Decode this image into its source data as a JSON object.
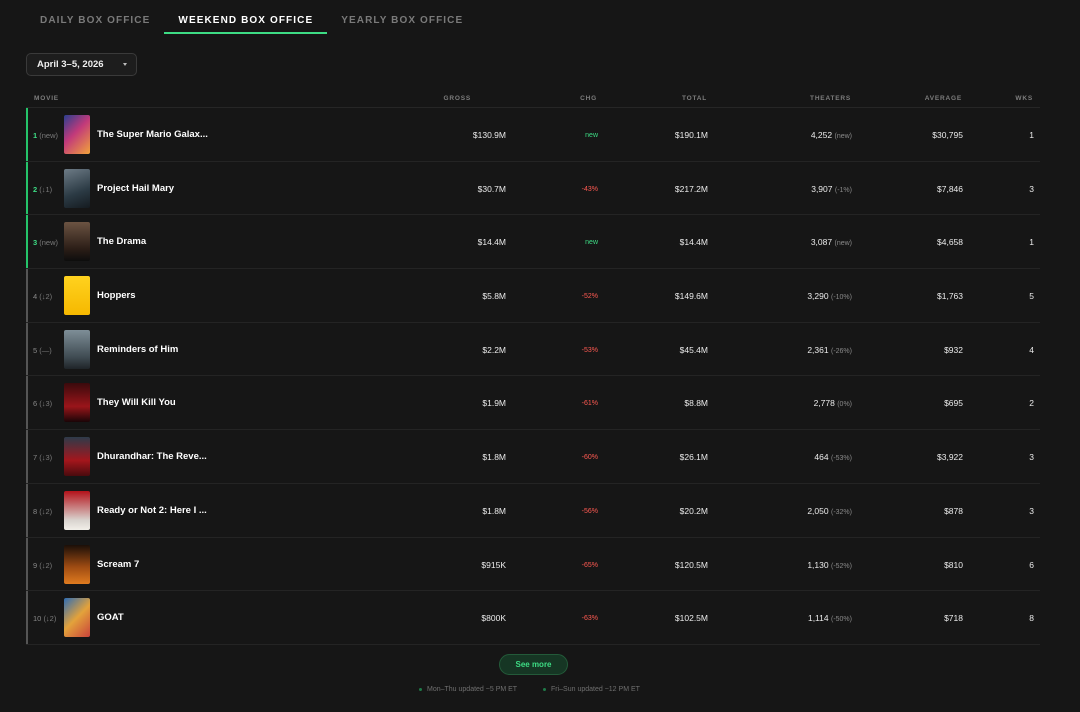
{
  "tabs": [
    {
      "label": "DAILY BOX OFFICE",
      "active": false
    },
    {
      "label": "WEEKEND BOX OFFICE",
      "active": true
    },
    {
      "label": "YEARLY BOX OFFICE",
      "active": false
    }
  ],
  "date_select": {
    "value": "April 3–5, 2026"
  },
  "columns": {
    "movie": "MOVIE",
    "gross": "GROSS",
    "chg": "CHG",
    "total": "TOTAL",
    "theaters": "THEATERS",
    "average": "AVERAGE",
    "wks": "WKS"
  },
  "rows": [
    {
      "rank": "1",
      "rank_change": "(new)",
      "title": "The Super Mario Galax...",
      "gross": "$130.9M",
      "chg": "new",
      "total": "$190.1M",
      "theaters": "4,252",
      "theaters_change": "(new)",
      "average": "$30,795",
      "wks": "1"
    },
    {
      "rank": "2",
      "rank_change": "(↓1)",
      "title": "Project Hail Mary",
      "gross": "$30.7M",
      "chg": "-43%",
      "total": "$217.2M",
      "theaters": "3,907",
      "theaters_change": "(-1%)",
      "average": "$7,846",
      "wks": "3"
    },
    {
      "rank": "3",
      "rank_change": "(new)",
      "title": "The Drama",
      "gross": "$14.4M",
      "chg": "new",
      "total": "$14.4M",
      "theaters": "3,087",
      "theaters_change": "(new)",
      "average": "$4,658",
      "wks": "1"
    },
    {
      "rank": "4",
      "rank_change": "(↓2)",
      "title": "Hoppers",
      "gross": "$5.8M",
      "chg": "-52%",
      "total": "$149.6M",
      "theaters": "3,290",
      "theaters_change": "(-10%)",
      "average": "$1,763",
      "wks": "5"
    },
    {
      "rank": "5",
      "rank_change": "(—)",
      "title": "Reminders of Him",
      "gross": "$2.2M",
      "chg": "-53%",
      "total": "$45.4M",
      "theaters": "2,361",
      "theaters_change": "(-26%)",
      "average": "$932",
      "wks": "4"
    },
    {
      "rank": "6",
      "rank_change": "(↓3)",
      "title": "They Will Kill You",
      "gross": "$1.9M",
      "chg": "-61%",
      "total": "$8.8M",
      "theaters": "2,778",
      "theaters_change": "(0%)",
      "average": "$695",
      "wks": "2"
    },
    {
      "rank": "7",
      "rank_change": "(↓3)",
      "title": "Dhurandhar: The Reve...",
      "gross": "$1.8M",
      "chg": "-60%",
      "total": "$26.1M",
      "theaters": "464",
      "theaters_change": "(-53%)",
      "average": "$3,922",
      "wks": "3"
    },
    {
      "rank": "8",
      "rank_change": "(↓2)",
      "title": "Ready or Not 2: Here I ...",
      "gross": "$1.8M",
      "chg": "-56%",
      "total": "$20.2M",
      "theaters": "2,050",
      "theaters_change": "(-32%)",
      "average": "$878",
      "wks": "3"
    },
    {
      "rank": "9",
      "rank_change": "(↓2)",
      "title": "Scream 7",
      "gross": "$915K",
      "chg": "-65%",
      "total": "$120.5M",
      "theaters": "1,130",
      "theaters_change": "(-52%)",
      "average": "$810",
      "wks": "6"
    },
    {
      "rank": "10",
      "rank_change": "(↓2)",
      "title": "GOAT",
      "gross": "$800K",
      "chg": "-63%",
      "total": "$102.5M",
      "theaters": "1,114",
      "theaters_change": "(-50%)",
      "average": "$718",
      "wks": "8"
    }
  ],
  "see_more": "See more",
  "footer": {
    "weekday_note": "Mon–Thu updated ~5 PM ET",
    "weekend_note": "Fri–Sun updated ~12 PM ET"
  },
  "colors": {
    "accent": "#3ddc84",
    "negative": "#ff5a52",
    "background": "#161616"
  }
}
